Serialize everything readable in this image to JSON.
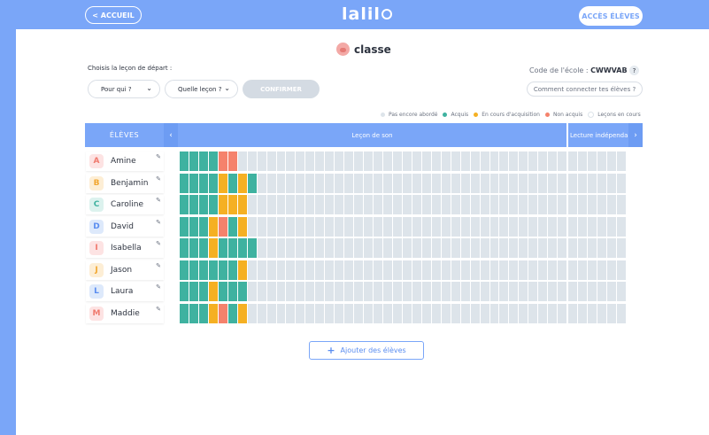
{
  "nav": {
    "back_label": "< ACCUEIL",
    "logo_text": "lalil",
    "student_access_label": "ACCÈS ÉLÈVES"
  },
  "classroom": {
    "name": "classe",
    "icon": "pig-icon"
  },
  "controls": {
    "choose_label": "Choisis la leçon de départ :",
    "who_select": "Pour qui ?",
    "lesson_select": "Quelle leçon ?",
    "confirm_label": "CONFIRMER"
  },
  "school": {
    "code_label": "Code de l'école :",
    "code_value": "CWWVAB",
    "help": "?",
    "connect_label": "Comment connecter tes élèves ?"
  },
  "legend": [
    {
      "label": "Pas encore abordé",
      "color": "#dde4ea"
    },
    {
      "label": "Acquis",
      "color": "#3fb2a0"
    },
    {
      "label": "En cours d'acquisition",
      "color": "#f5b023"
    },
    {
      "label": "Non acquis",
      "color": "#f5826c"
    },
    {
      "label": "Leçons en cours",
      "color": "#ffffff"
    }
  ],
  "table": {
    "students_header": "ÉLÈVES",
    "lesson_header": "Leçon de son",
    "lecture_header": "Lecture indépendante",
    "prev": "‹",
    "next": "›"
  },
  "students": [
    {
      "name": "Amine",
      "letter": "A",
      "avatar_bg": "#fde3e3",
      "avatar_fg": "#f07a6e",
      "progress": [
        "A",
        "A",
        "A",
        "A",
        "N",
        "N"
      ]
    },
    {
      "name": "Benjamin",
      "letter": "B",
      "avatar_bg": "#fdeed5",
      "avatar_fg": "#f2a731",
      "progress": [
        "A",
        "A",
        "A",
        "A",
        "E",
        "A",
        "E",
        "A"
      ]
    },
    {
      "name": "Caroline",
      "letter": "C",
      "avatar_bg": "#dcf2ee",
      "avatar_fg": "#3fb2a0",
      "progress": [
        "A",
        "A",
        "A",
        "A",
        "E",
        "E",
        "E"
      ]
    },
    {
      "name": "David",
      "letter": "D",
      "avatar_bg": "#dde9fb",
      "avatar_fg": "#5a8df0",
      "progress": [
        "A",
        "A",
        "A",
        "E",
        "N",
        "A",
        "E"
      ]
    },
    {
      "name": "Isabella",
      "letter": "I",
      "avatar_bg": "#fde3e3",
      "avatar_fg": "#f07a6e",
      "progress": [
        "A",
        "A",
        "A",
        "E",
        "A",
        "A",
        "A",
        "A"
      ]
    },
    {
      "name": "Jason",
      "letter": "J",
      "avatar_bg": "#fdeed5",
      "avatar_fg": "#f2a731",
      "progress": [
        "A",
        "A",
        "A",
        "A",
        "A",
        "A",
        "E"
      ]
    },
    {
      "name": "Laura",
      "letter": "L",
      "avatar_bg": "#dde9fb",
      "avatar_fg": "#5a8df0",
      "progress": [
        "A",
        "A",
        "A",
        "E",
        "A",
        "A",
        "A"
      ]
    },
    {
      "name": "Maddie",
      "letter": "M",
      "avatar_bg": "#fde3e3",
      "avatar_fg": "#f07a6e",
      "progress": [
        "A",
        "A",
        "A",
        "E",
        "N",
        "A",
        "E"
      ]
    }
  ],
  "add_students_label": "Ajouter des élèves"
}
